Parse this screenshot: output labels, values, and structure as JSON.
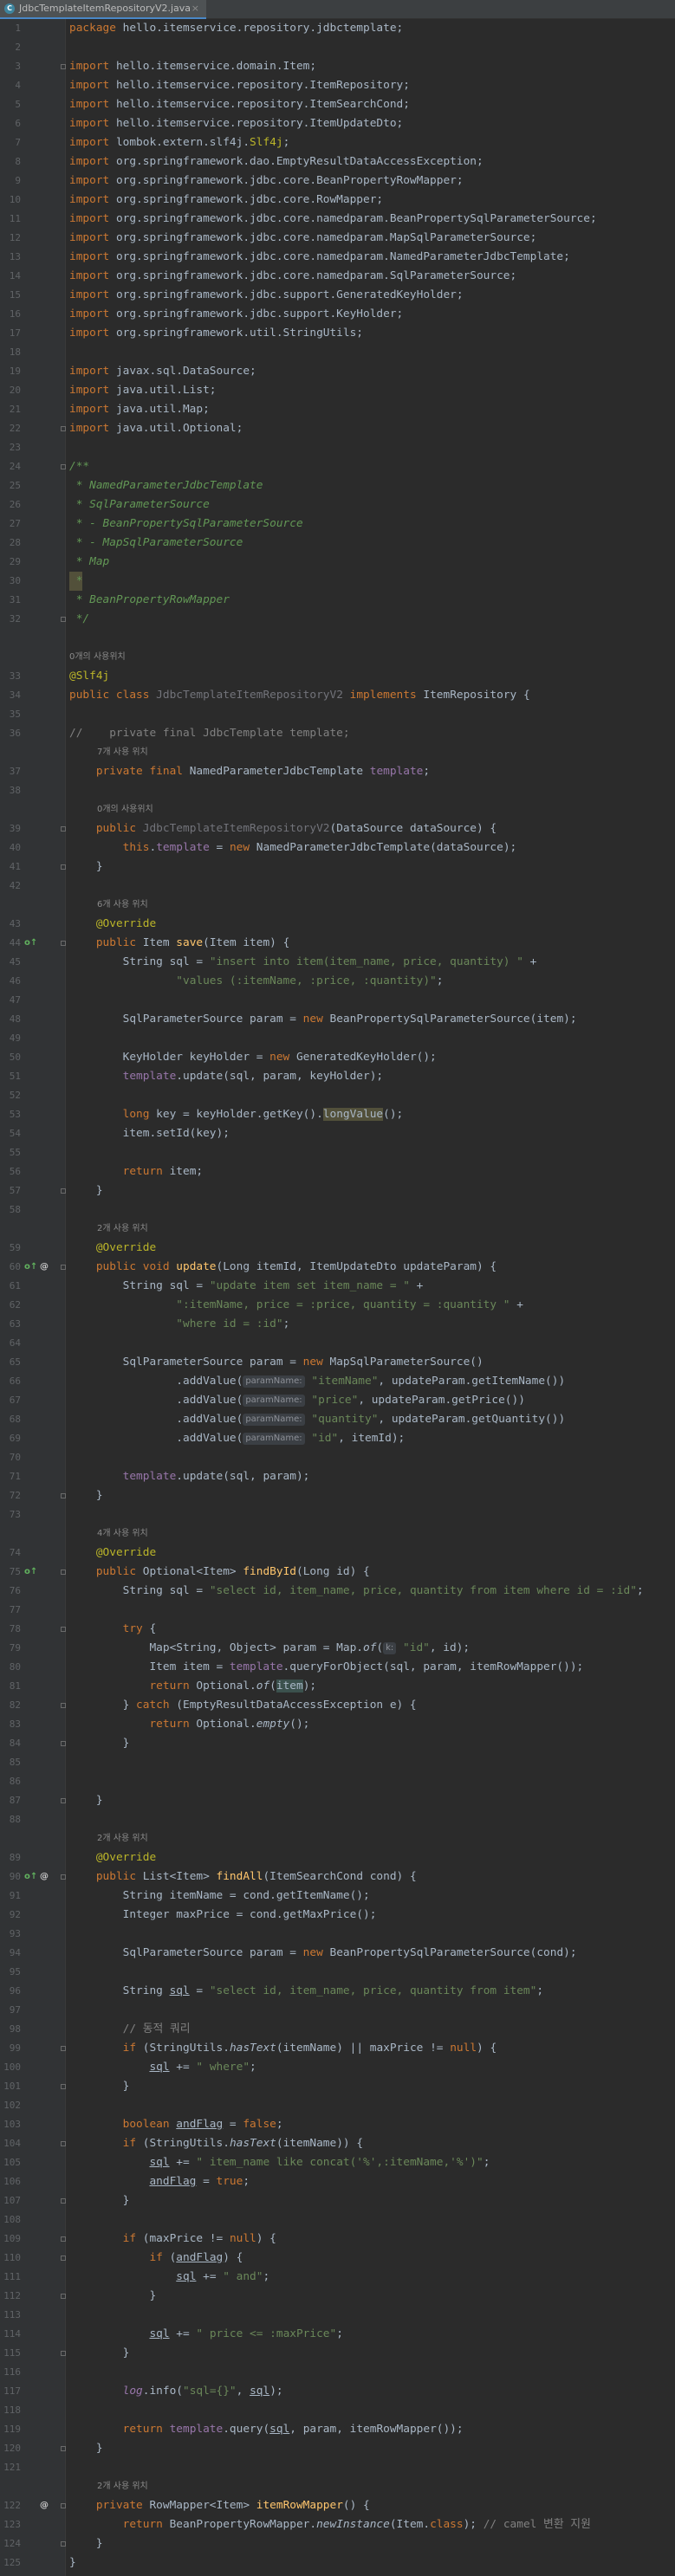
{
  "tab": {
    "file_name": "JdbcTemplateItemRepositoryV2.java",
    "icon": "C",
    "close_label": "×"
  },
  "hints": {
    "usages_0": "0개의 사용위치",
    "usages_7": "7개 사용 위치",
    "usages_6": "6개 사용 위치",
    "usages_2": "2개 사용 위치",
    "usages_4": "4개 사용 위치",
    "param_key": "k:",
    "param_name": "paramName:"
  },
  "code": {
    "l1": "hello.itemservice.repository.jdbctemplate;",
    "l3": "hello.itemservice.domain.Item;",
    "l4": "hello.itemservice.repository.ItemRepository;",
    "l5": "hello.itemservice.repository.ItemSearchCond;",
    "l6": "hello.itemservice.repository.ItemUpdateDto;",
    "l7": "lombok.extern.slf4j.",
    "l7b": "Slf4j",
    "l8": "org.springframework.dao.EmptyResultDataAccessException;",
    "l9": "org.springframework.jdbc.core.BeanPropertyRowMapper;",
    "l10": "org.springframework.jdbc.core.RowMapper;",
    "l11": "org.springframework.jdbc.core.namedparam.BeanPropertySqlParameterSource;",
    "l12": "org.springframework.jdbc.core.namedparam.MapSqlParameterSource;",
    "l13": "org.springframework.jdbc.core.namedparam.NamedParameterJdbcTemplate;",
    "l14": "org.springframework.jdbc.core.namedparam.SqlParameterSource;",
    "l15": "org.springframework.jdbc.support.GeneratedKeyHolder;",
    "l16": "org.springframework.jdbc.support.KeyHolder;",
    "l17": "org.springframework.util.StringUtils;",
    "l19": "javax.sql.DataSource;",
    "l20": "java.util.List;",
    "l21": "java.util.Map;",
    "l22": "java.util.Optional;",
    "l24": "/**",
    "l25": " * NamedParameterJdbcTemplate",
    "l26": " * SqlParameterSource",
    "l27": " * - BeanPropertySqlParameterSource",
    "l28": " * - MapSqlParameterSource",
    "l29": " * Map",
    "l30": " *",
    "l31": " * BeanPropertyRowMapper",
    "l32": " */",
    "l33": "@Slf4j",
    "l34_cls": "JdbcTemplateItemRepositoryV2",
    "l34_rest": "ItemRepository {",
    "l36": "//    private final JdbcTemplate template;",
    "l37_type": "NamedParameterJdbcTemplate ",
    "l37_name": "template",
    "l39_cls": "JdbcTemplateItemRepositoryV2",
    "l39_rest": "(DataSource dataSource) {",
    "l40_rest": "NamedParameterJdbcTemplate(dataSource);",
    "ovr": "@Override",
    "l44_m": "save",
    "l44_r": "(Item item) {",
    "l45_a": "String sql = ",
    "l45_s": "\"insert into item(item_name, price, quantity) \"",
    "l46_s": "\"values (:itemName, :price, :quantity)\"",
    "l48_a": "SqlParameterSource param = ",
    "l48_b": "BeanPropertySqlParameterSource(item);",
    "l50_a": "KeyHolder keyHolder = ",
    "l50_b": "GeneratedKeyHolder();",
    "l51_b": ".update(sql, param, keyHolder);",
    "l53_a": " key = keyHolder.getKey().",
    "l53_b": "longValue",
    "l53_c": "();",
    "l54": "item.setId(key);",
    "l56_b": " item;",
    "l60_m": "update",
    "l60_r": "(Long itemId, ItemUpdateDto updateParam) {",
    "l61_s": "\"update item set item_name = \"",
    "l62_s": "\":itemName, price = :price, quantity = :quantity \"",
    "l63_s": "\"where id = :id\"",
    "l65_b": "MapSqlParameterSource()",
    "l66_s": "\"itemName\"",
    "l66_r": ", updateParam.getItemName())",
    "l67_s": "\"price\"",
    "l67_r": ", updateParam.getPrice())",
    "l68_s": "\"quantity\"",
    "l68_r": ", updateParam.getQuantity())",
    "l69_s": "\"id\"",
    "l69_r": ", itemId);",
    "add": ".addValue(",
    "l71_b": ".update(sql, param);",
    "l75_a": "Optional<Item> ",
    "l75_m": "findById",
    "l75_r": "(Long id) {",
    "l76_s": "\"select id, item_name, price, quantity from item where id = :id\"",
    "l78": "try {",
    "l79_a": "Map<String, Object> param = Map.",
    "l79_m": "of",
    "l79_s": "\"id\"",
    "l79_r": ", id);",
    "l80_a": "Item item = ",
    "l80_b": ".queryForObject(sql, param, itemRowMapper());",
    "l81_a": "Optional.",
    "l81_m": "of",
    "l81_b": "item",
    "l82_b": " (EmptyResultDataAccessException e) {",
    "l83_a": "Optional.",
    "l83_m": "empty",
    "l90_a": "List<Item> ",
    "l90_m": "findAll",
    "l90_r": "(ItemSearchCond cond) {",
    "l91": "String itemName = cond.getItemName();",
    "l92": "Integer maxPrice = cond.getMaxPrice();",
    "l94_a": "SqlParameterSource param = ",
    "l94_b": "BeanPropertySqlParameterSource(cond);",
    "l96_a": "String ",
    "l96_v": "sql",
    "l96_s": "\"select id, item_name, price, quantity from item\"",
    "l98": "// 동적 쿼리",
    "l99_a": " (StringUtils.",
    "l99_m": "hasText",
    "l99_b": "(itemName) || maxPrice != ",
    "l100_s": "\" where\"",
    "sqlv": "sql",
    "flag": "andFlag",
    "l103_a": "boolean ",
    "l104_m": "hasText",
    "l104_b": "(itemName)) {",
    "l105_s": "\" item_name like concat('%',:itemName,'%')\"",
    "l109_a": " (maxPrice != ",
    "l111_s": "\" and\"",
    "l114_s": "\" price <= :maxPrice\"",
    "l117_a": "log",
    "l117_b": ".info(",
    "l117_s": "\"sql={}\"",
    "l119_b": ".query(",
    "l119_c": ", param, itemRowMapper());",
    "l123_a": "RowMapper<Item> ",
    "l123_m": "itemRowMapper",
    "l123_r": "() {",
    "l124_a": "BeanPropertyRowMapper.",
    "l124_m": "newInstance",
    "l124_b": "(Item.",
    "l124_c": "); ",
    "l124_cm": "// camel 변환 지원"
  }
}
